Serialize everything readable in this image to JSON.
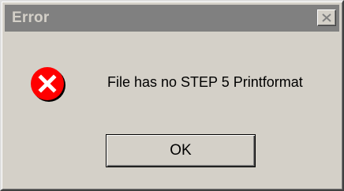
{
  "window": {
    "title": "Error",
    "title_bar_color": "#808080",
    "title_text_color": "#d4d0c8",
    "close_icon": "close-icon"
  },
  "dialog": {
    "icon": "error-icon",
    "icon_color": "#ff0000",
    "message": "File has no STEP 5 Printformat",
    "ok_label": "OK"
  }
}
